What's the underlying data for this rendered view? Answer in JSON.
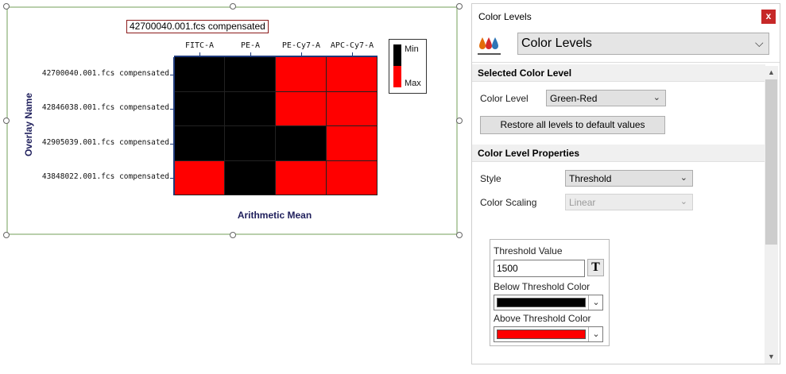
{
  "plot": {
    "title": "42700040.001.fcs compensated",
    "x_axis_title": "Arithmetic Mean",
    "y_axis_title": "Overlay Name",
    "legend": {
      "min_label": "Min",
      "max_label": "Max"
    }
  },
  "chart_data": {
    "type": "heatmap",
    "columns": [
      "FITC-A",
      "PE-A",
      "PE-Cy7-A",
      "APC-Cy7-A"
    ],
    "rows": [
      "42700040.001.fcs compensated",
      "42846038.001.fcs compensated",
      "42905039.001.fcs compensated",
      "43848022.001.fcs compensated"
    ],
    "values": [
      [
        "below",
        "below",
        "above",
        "above"
      ],
      [
        "below",
        "below",
        "above",
        "above"
      ],
      [
        "below",
        "below",
        "below",
        "above"
      ],
      [
        "above",
        "below",
        "above",
        "above"
      ]
    ],
    "colors": {
      "below": "#000000",
      "above": "#ff0000"
    },
    "xlabel": "Arithmetic Mean",
    "ylabel": "Overlay Name"
  },
  "panel": {
    "title": "Color Levels",
    "close_label": "x",
    "top_select": "Color Levels",
    "section_selected": "Selected Color Level",
    "color_level_label": "Color Level",
    "color_level_value": "Green-Red",
    "restore_button": "Restore all levels to default values",
    "section_properties": "Color Level Properties",
    "style_label": "Style",
    "style_value": "Threshold",
    "scaling_label": "Color Scaling",
    "scaling_value": "Linear",
    "threshold_label": "Threshold Value",
    "threshold_value": "1500",
    "threshold_t": "T",
    "below_label": "Below Threshold Color",
    "below_color": "#000000",
    "above_label": "Above Threshold Color",
    "above_color": "#ff0000"
  },
  "icons": {
    "drops": "color-drops-icon",
    "chevron": "⌵",
    "chev_small": "⌄",
    "scroll_up": "▲",
    "scroll_down": "▼",
    "dd": "⌄"
  },
  "drop_colors": [
    "#e36c0a",
    "#d62a2a",
    "#f0b400",
    "#2e75b6"
  ]
}
